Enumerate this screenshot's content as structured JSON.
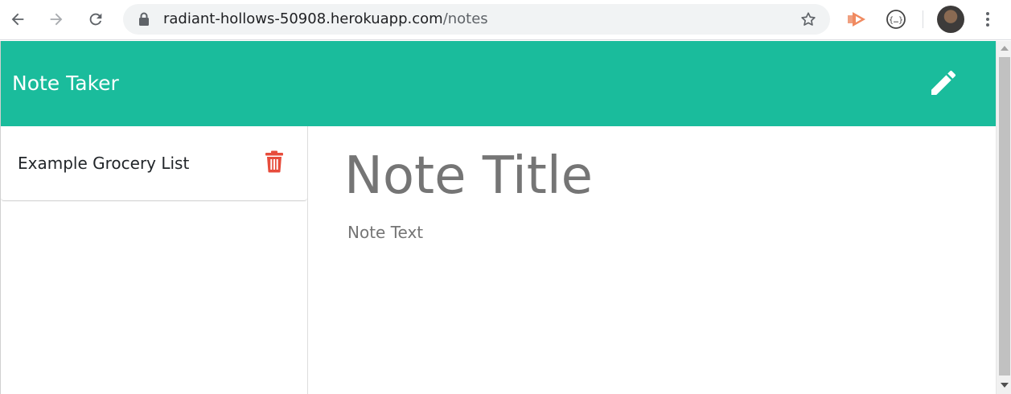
{
  "browser": {
    "url_host": "radiant-hollows-50908.herokuapp.com",
    "url_path": "/notes",
    "icons": {
      "back": "arrow-left-icon",
      "forward": "arrow-right-icon",
      "reload": "reload-icon",
      "lock": "lock-icon",
      "bookmark": "star-icon",
      "extension_1": "extension-play-icon",
      "extension_2": "extension-braces-icon",
      "menu": "kebab-menu-icon"
    }
  },
  "app": {
    "title": "Note Taker",
    "accent_color": "#1abc9c",
    "new_note_icon": "pencil-icon"
  },
  "sidebar": {
    "notes": [
      {
        "title": "Example Grocery List",
        "delete_icon": "trash-icon",
        "delete_color": "#e74c3c"
      }
    ]
  },
  "editor": {
    "title_placeholder": "Note Title",
    "text_placeholder": "Note Text"
  }
}
